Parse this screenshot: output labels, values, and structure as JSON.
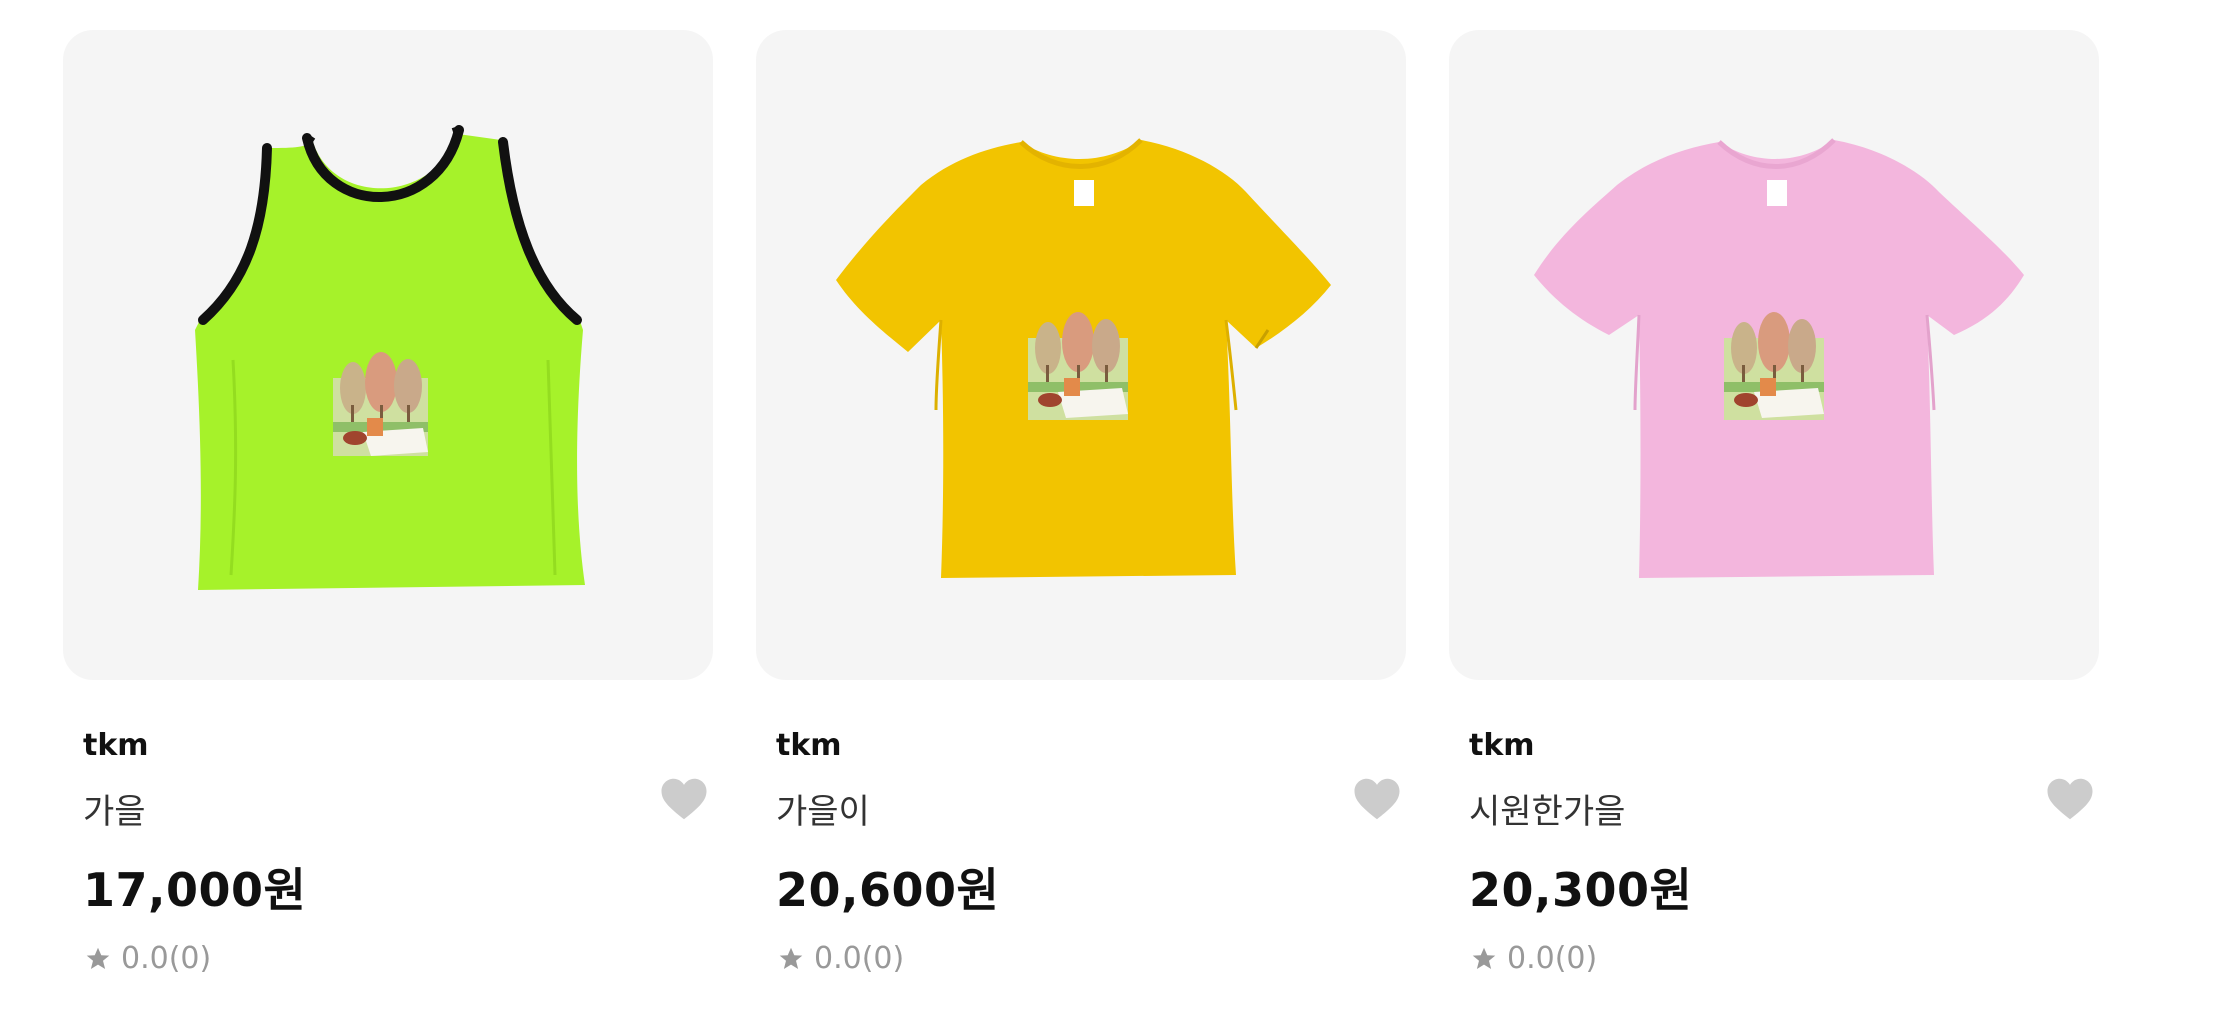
{
  "products": [
    {
      "seller": "tkm",
      "title": "가을",
      "price": "17,000원",
      "rating": "0.0(0)",
      "garment": "tank-top",
      "garment_color": "#a6f22a",
      "trim_color": "#111111",
      "icon_heart": "heart-icon",
      "icon_star": "star-icon"
    },
    {
      "seller": "tkm",
      "title": "가을이",
      "price": "20,600원",
      "rating": "0.0(0)",
      "garment": "t-shirt",
      "garment_color": "#f2c400",
      "icon_heart": "heart-icon",
      "icon_star": "star-icon"
    },
    {
      "seller": "tkm",
      "title": "시원한가을",
      "price": "20,300원",
      "rating": "0.0(0)",
      "garment": "t-shirt",
      "garment_color": "#f3b6dd",
      "icon_heart": "heart-icon",
      "icon_star": "star-icon"
    }
  ],
  "colors": {
    "thumb_bg": "#f5f5f5",
    "heart": "#cccccc",
    "star": "#999999"
  }
}
